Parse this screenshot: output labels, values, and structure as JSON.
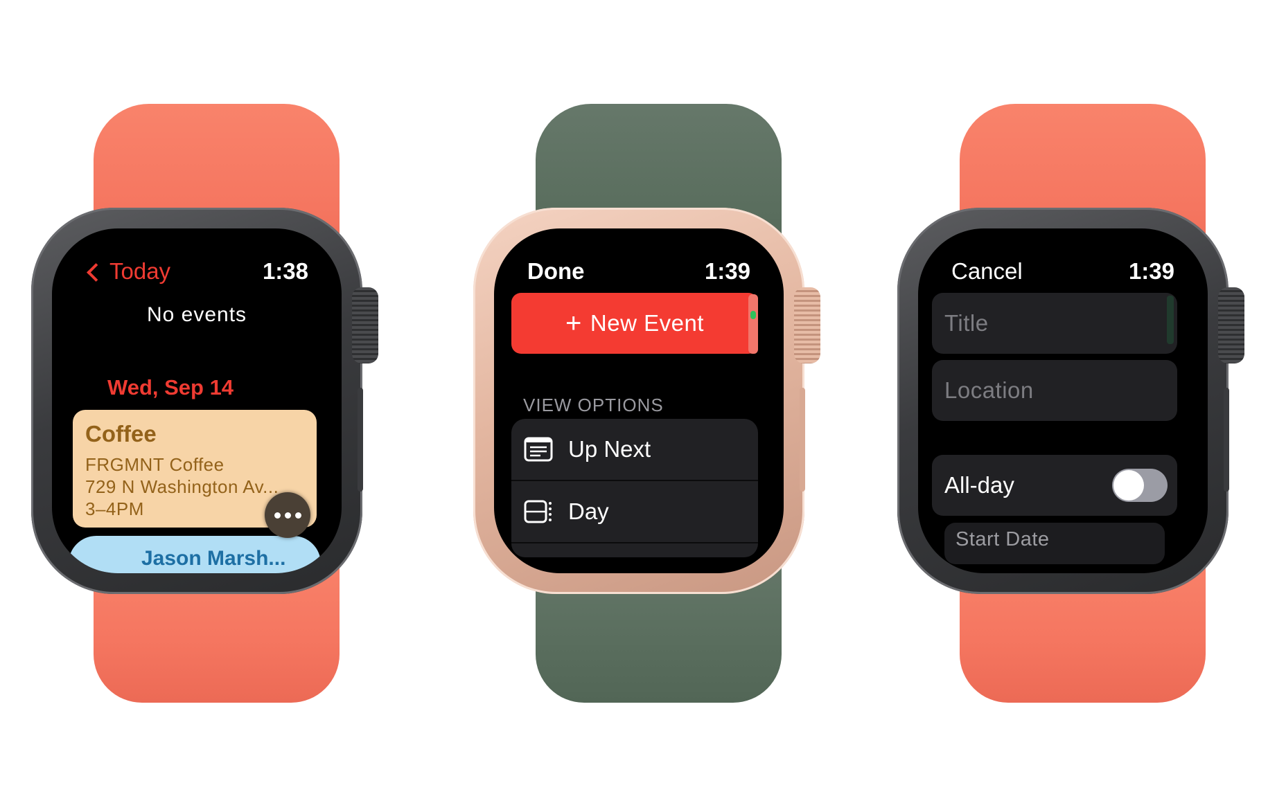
{
  "watches": [
    {
      "band_color": "coral",
      "case_finish": "space gray",
      "screen": {
        "nav": {
          "back_label": "Today",
          "time": "1:38"
        },
        "empty_message": "No events",
        "date_header": "Wed, Sep 14",
        "event": {
          "title": "Coffee",
          "place": "FRGMNT Coffee",
          "address": "729 N Washington Av...",
          "time_range": "3–4PM",
          "color": "#f7d4a7"
        },
        "more_button_icon": "ellipsis-icon",
        "next_event_partial": "Jason Marsh..."
      }
    },
    {
      "band_color": "green",
      "case_finish": "gold",
      "screen": {
        "nav": {
          "done_label": "Done",
          "time": "1:39"
        },
        "new_event_button": {
          "icon": "plus-icon",
          "label": "New Event",
          "color": "#f43b32"
        },
        "section_header": "VIEW OPTIONS",
        "view_options": [
          {
            "icon": "up-next-icon",
            "label": "Up Next"
          },
          {
            "icon": "day-view-icon",
            "label": "Day"
          }
        ]
      }
    },
    {
      "band_color": "coral",
      "case_finish": "space gray",
      "screen": {
        "nav": {
          "cancel_label": "Cancel",
          "time": "1:39"
        },
        "fields": {
          "title_placeholder": "Title",
          "location_placeholder": "Location"
        },
        "all_day": {
          "label": "All-day",
          "on": false
        },
        "start_date_label": "Start Date"
      }
    }
  ]
}
